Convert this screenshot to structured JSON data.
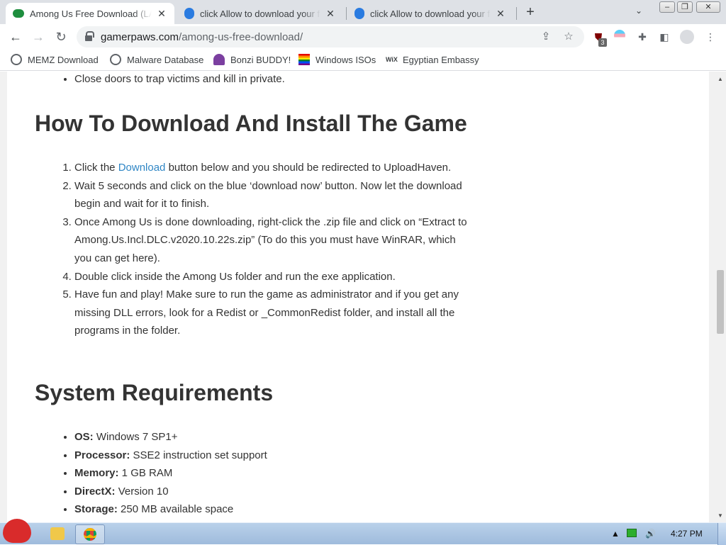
{
  "browser": {
    "tabs": [
      {
        "title": "Among Us Free Download (LATEST)",
        "active": true
      },
      {
        "title": "click Allow to download your file",
        "active": false
      },
      {
        "title": "click Allow to download your file",
        "active": false
      }
    ],
    "new_tab": "+",
    "url_domain": "gamerpaws.com",
    "url_path": "/among-us-free-download/",
    "extension_badge": "3",
    "bookmarks": [
      {
        "label": "MEMZ Download",
        "icon": "globe-icon"
      },
      {
        "label": "Malware Database",
        "icon": "globe-icon"
      },
      {
        "label": "Bonzi BUDDY!",
        "icon": "bonzi-icon"
      },
      {
        "label": "Windows ISOs",
        "icon": "rainbow-flag-icon"
      },
      {
        "label": "Egyptian Embassy",
        "icon": "wix-icon"
      }
    ]
  },
  "article": {
    "prev_bullet": "Close doors to trap victims and kill in private.",
    "install_heading": "How To Download And Install The Game",
    "install_step1_pre": "Click the ",
    "install_step1_link": "Download",
    "install_step1_post": " button below and you should be redirected to UploadHaven.",
    "install_step2": "Wait 5 seconds and click on the blue ‘download now’ button. Now let the download begin and wait for it to finish.",
    "install_step3": "Once Among Us is done downloading, right-click the .zip file and click on “Extract to Among.Us.Incl.DLC.v2020.10.22s.zip” (To do this you must have WinRAR, which you can get here).",
    "install_step4": "Double click inside the Among Us folder and run the exe application.",
    "install_step5": "Have fun and play! Make sure to run the game as administrator and if you get any missing DLL errors, look for a Redist or _CommonRedist folder, and install all the programs in the folder.",
    "req_heading": "System Requirements",
    "requirements": [
      {
        "label": "OS:",
        "value": " Windows 7 SP1+"
      },
      {
        "label": "Processor:",
        "value": " SSE2 instruction set support"
      },
      {
        "label": "Memory:",
        "value": " 1 GB RAM"
      },
      {
        "label": "DirectX:",
        "value": " Version 10"
      },
      {
        "label": "Storage:",
        "value": " 250 MB available space"
      }
    ]
  },
  "taskbar": {
    "clock": "4:27 PM"
  },
  "colors": {
    "link": "#2f86c5",
    "tab_strip": "#dee1e6",
    "taskbar": "#b9d1ea"
  }
}
